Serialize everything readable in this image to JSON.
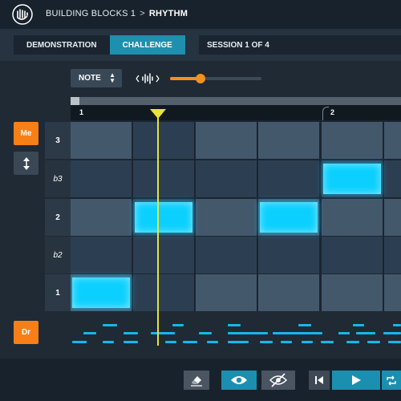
{
  "header": {
    "breadcrumb_parent": "BUILDING BLOCKS 1",
    "breadcrumb_sep": ">",
    "breadcrumb_current": "RHYTHM"
  },
  "modes": {
    "demonstration_label": "DEMONSTRATION",
    "challenge_label": "CHALLENGE",
    "active": "CHALLENGE",
    "session_label": "SESSION 1 OF 4"
  },
  "toolbar": {
    "note_dropdown_value": "NOTE",
    "volume_level": 0.33,
    "accent_color": "#f39021"
  },
  "ruler": {
    "bars": [
      "1",
      "2"
    ]
  },
  "tracks": {
    "melody_label": "Me",
    "drums_label": "Dr"
  },
  "pitch_rows": [
    "3",
    "b3",
    "2",
    "b2",
    "1"
  ],
  "notes": [
    {
      "row": "1",
      "beat": 1
    },
    {
      "row": "2",
      "beat": 2
    },
    {
      "row": "2",
      "beat": 4
    },
    {
      "row": "b3",
      "beat": 5
    }
  ],
  "colors": {
    "note": "#0bd0ff",
    "playhead": "#e8e43a",
    "track_button": "#f77f16",
    "active_tab": "#1f8fae"
  },
  "icons": {
    "logo": "hand-music-logo-icon",
    "wave": "waveform-icon",
    "updown": "up-down-arrows-icon",
    "erase": "eraser-icon",
    "show": "eye-icon",
    "hide": "eye-off-icon",
    "prev": "skip-back-icon",
    "play": "play-icon",
    "loop": "loop-icon"
  }
}
